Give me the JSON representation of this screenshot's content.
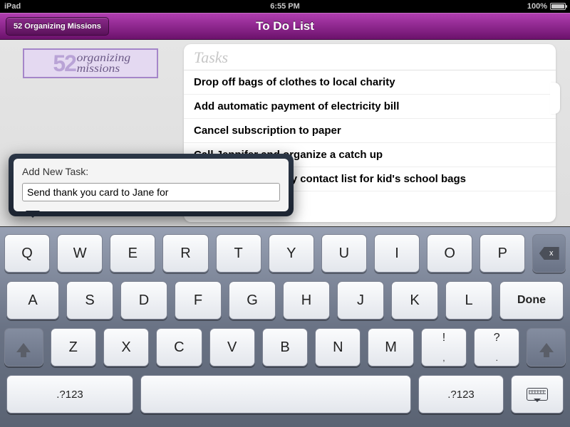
{
  "statusbar": {
    "device": "iPad",
    "time": "6:55 PM",
    "battery_pct": "100%"
  },
  "navbar": {
    "back_label": "52 Organizing Missions",
    "title": "To Do List"
  },
  "logo": {
    "number": "52",
    "line1": "organizing",
    "line2": "missions"
  },
  "tasks": {
    "heading": "Tasks",
    "items": [
      "Drop off bags of clothes to local charity",
      "Add automatic payment of electricity bill",
      "Cancel subscription to paper",
      "Call Jennifer and organize a catch up",
      "Print out emergency contact list for kid's school bags"
    ]
  },
  "popover": {
    "label": "Add New Task:",
    "value": "Send thank you card to Jane for"
  },
  "keyboard": {
    "row1": [
      "Q",
      "W",
      "E",
      "R",
      "T",
      "Y",
      "U",
      "I",
      "O",
      "P"
    ],
    "row2": [
      "A",
      "S",
      "D",
      "F",
      "G",
      "H",
      "J",
      "K",
      "L"
    ],
    "row3": [
      "Z",
      "X",
      "C",
      "V",
      "B",
      "N",
      "M"
    ],
    "punct1_top": "!",
    "punct1_bot": ",",
    "punct2_top": "?",
    "punct2_bot": ".",
    "done": "Done",
    "mode": ".?123",
    "backspace_x": "x"
  }
}
